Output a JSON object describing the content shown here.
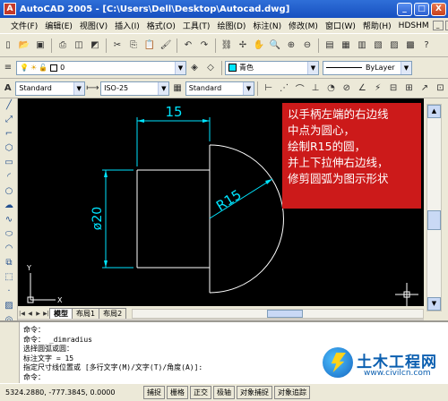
{
  "window": {
    "title": "AutoCAD 2005 - [C:\\Users\\Dell\\Desktop\\Autocad.dwg]",
    "app_icon": "A",
    "controls": [
      "_",
      "□",
      "X"
    ]
  },
  "menubar": {
    "items": [
      "文件(F)",
      "编辑(E)",
      "视图(V)",
      "插入(I)",
      "格式(O)",
      "工具(T)",
      "绘图(D)",
      "标注(N)",
      "修改(M)",
      "窗口(W)",
      "帮助(H)",
      "HDSHM"
    ],
    "mdi_controls": [
      "_",
      "□",
      "x"
    ]
  },
  "toolbar_layers": {
    "layer_value": "0",
    "color_value": "青色",
    "linetype_value": "ByLayer"
  },
  "toolbar_styles": {
    "text_style": "Standard",
    "dim_style": "ISO-25",
    "table_style": "Standard"
  },
  "drawing": {
    "dims": {
      "width": "15",
      "height": "ø20",
      "radius": "R15"
    },
    "ucs": {
      "x": "X",
      "y": "Y"
    },
    "colors": {
      "geometry": "#ffffff",
      "dimension": "#00e5ff",
      "background": "#000000"
    }
  },
  "note": {
    "lines": [
      "以手柄左端的右边线",
      "中点为圆心，",
      "绘制R15的圆，",
      "并上下拉伸右边线，",
      "修剪圆弧为图示形状"
    ],
    "bg_color": "#cc1a1a"
  },
  "layout_tabs": [
    "模型",
    "布局1",
    "布局2"
  ],
  "command_window": {
    "lines": [
      "命令：",
      "命令： _dimradius",
      "选择圆弧或圆：",
      "标注文字 = 15",
      "指定尺寸线位置或 [多行文字(M)/文字(T)/角度(A)]:",
      "命令："
    ]
  },
  "statusbar": {
    "coords": "5324.2880, -777.3845, 0.0000",
    "buttons": [
      "捕捉",
      "栅格",
      "正交",
      "极轴",
      "对象捕捉",
      "对象追踪"
    ]
  },
  "watermark": {
    "title": "土木工程网",
    "url": "www.civilcn.com"
  }
}
